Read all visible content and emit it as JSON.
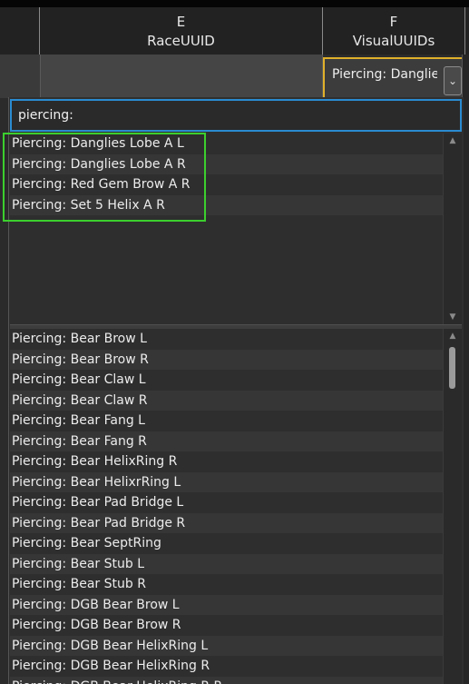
{
  "columns": [
    {
      "letter": "E",
      "name": "RaceUUID"
    },
    {
      "letter": "F",
      "name": "VisualUUIDs"
    }
  ],
  "active_cell": {
    "value": "Piercing: Danglies"
  },
  "dropdown_icon": "chevron-down-icon",
  "search": {
    "value": "piercing:"
  },
  "filtered_items": [
    "Piercing: Danglies Lobe A L",
    "Piercing: Danglies Lobe A R",
    "Piercing: Red Gem Brow A R",
    "Piercing: Set 5 Helix A R"
  ],
  "all_items": [
    "Piercing: Bear Brow L",
    "Piercing: Bear Brow R",
    "Piercing: Bear Claw L",
    "Piercing: Bear Claw R",
    "Piercing: Bear Fang L",
    "Piercing: Bear Fang R",
    "Piercing: Bear HelixRing R",
    "Piercing: Bear HelixrRing L",
    "Piercing: Bear Pad Bridge L",
    "Piercing: Bear Pad Bridge R",
    "Piercing: Bear SeptRing",
    "Piercing: Bear Stub L",
    "Piercing: Bear Stub R",
    "Piercing: DGB Bear Brow L",
    "Piercing: DGB Bear Brow R",
    "Piercing: DGB Bear HelixRing L",
    "Piercing: DGB Bear HelixRing R",
    "Piercing: DGB Bear HelixRing R R"
  ],
  "colors": {
    "highlight": "#3ccf2e",
    "focus_border": "#2a8bd0",
    "active_cell_border": "#e0b02a"
  }
}
